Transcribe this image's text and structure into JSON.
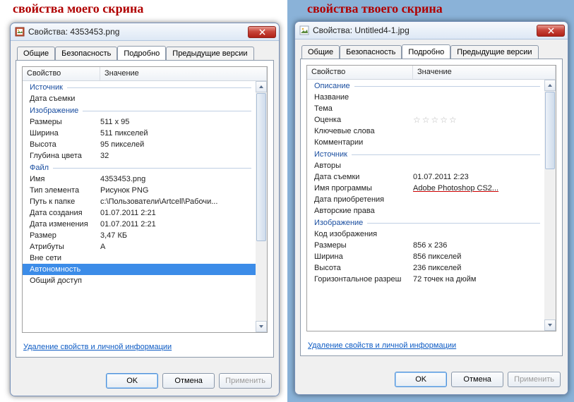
{
  "left": {
    "caption": "свойства моего скрина",
    "title": "Свойства: 4353453.png",
    "tabs": [
      "Общие",
      "Безопасность",
      "Подробно",
      "Предыдущие версии"
    ],
    "active_tab": 2,
    "columns": {
      "prop": "Свойство",
      "val": "Значение"
    },
    "sections": [
      {
        "title": "Источник",
        "rows": [
          {
            "name": "Дата съемки",
            "val": ""
          }
        ]
      },
      {
        "title": "Изображение",
        "rows": [
          {
            "name": "Размеры",
            "val": "511 x 95"
          },
          {
            "name": "Ширина",
            "val": "511 пикселей"
          },
          {
            "name": "Высота",
            "val": "95 пикселей"
          },
          {
            "name": "Глубина цвета",
            "val": "32"
          }
        ]
      },
      {
        "title": "Файл",
        "rows": [
          {
            "name": "Имя",
            "val": "4353453.png"
          },
          {
            "name": "Тип элемента",
            "val": "Рисунок PNG"
          },
          {
            "name": "Путь к папке",
            "val": "c:\\Пользователи\\Artcell\\Рабочи..."
          },
          {
            "name": "Дата создания",
            "val": "01.07.2011 2:21"
          },
          {
            "name": "Дата изменения",
            "val": "01.07.2011 2:21"
          },
          {
            "name": "Размер",
            "val": "3,47 КБ"
          },
          {
            "name": "Атрибуты",
            "val": "A"
          },
          {
            "name": "Вне сети",
            "val": ""
          },
          {
            "name": "Автономность",
            "val": "",
            "selected": true
          },
          {
            "name": "Общий доступ",
            "val": ""
          }
        ]
      }
    ],
    "link": "Удаление свойств и личной информации",
    "buttons": {
      "ok": "OK",
      "cancel": "Отмена",
      "apply": "Применить"
    }
  },
  "right": {
    "caption": "свойства твоего скрина",
    "title": "Свойства: Untitled4-1.jpg",
    "tabs": [
      "Общие",
      "Безопасность",
      "Подробно",
      "Предыдущие версии"
    ],
    "active_tab": 2,
    "columns": {
      "prop": "Свойство",
      "val": "Значение"
    },
    "sections": [
      {
        "title": "Описание",
        "rows": [
          {
            "name": "Название",
            "val": ""
          },
          {
            "name": "Тема",
            "val": ""
          },
          {
            "name": "Оценка",
            "val": "",
            "stars": true
          },
          {
            "name": "Ключевые слова",
            "val": ""
          },
          {
            "name": "Комментарии",
            "val": ""
          }
        ]
      },
      {
        "title": "Источник",
        "rows": [
          {
            "name": "Авторы",
            "val": ""
          },
          {
            "name": "Дата съемки",
            "val": "01.07.2011 2:23"
          },
          {
            "name": "Имя программы",
            "val": "Adobe Photoshop CS2...",
            "underlined": true
          },
          {
            "name": "Дата приобретения",
            "val": ""
          },
          {
            "name": "Авторские права",
            "val": ""
          }
        ]
      },
      {
        "title": "Изображение",
        "rows": [
          {
            "name": "Код изображения",
            "val": ""
          },
          {
            "name": "Размеры",
            "val": "856 x 236"
          },
          {
            "name": "Ширина",
            "val": "856 пикселей"
          },
          {
            "name": "Высота",
            "val": "236 пикселей"
          },
          {
            "name": "Горизонтальное разреш",
            "val": "72 точек на дюйм"
          }
        ]
      }
    ],
    "link": "Удаление свойств и личной информации",
    "buttons": {
      "ok": "OK",
      "cancel": "Отмена",
      "apply": "Применить"
    }
  }
}
